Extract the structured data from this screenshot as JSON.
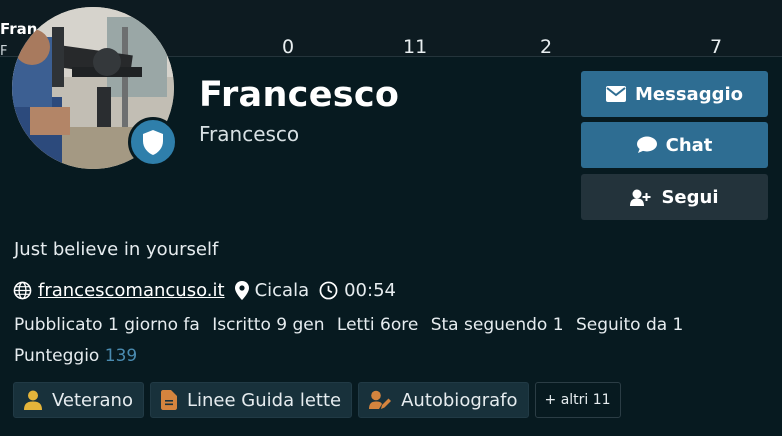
{
  "peek": {
    "title": "Fran",
    "subtitle": "F",
    "stats": [
      "0",
      "11",
      "2",
      "7"
    ]
  },
  "profile": {
    "display_name": "Francesco",
    "username": "Francesco",
    "motto": "Just believe in yourself",
    "website": "francescomancuso.it",
    "location": "Cicala",
    "local_time": "00:54"
  },
  "actions": {
    "message": "Messaggio",
    "chat": "Chat",
    "follow": "Segui"
  },
  "stats": {
    "posted": "Pubblicato 1 giorno fa",
    "joined": "Iscritto 9 gen",
    "read": "Letti 6ore",
    "following": "Sta seguendo 1",
    "followed": "Seguito da 1",
    "score_label": "Punteggio",
    "score_value": "139"
  },
  "badges": [
    {
      "label": "Veterano",
      "icon": "user-icon",
      "color": "#e4b43a"
    },
    {
      "label": "Linee Guida lette",
      "icon": "document-icon",
      "color": "#d4843e"
    },
    {
      "label": "Autobiografo",
      "icon": "user-edit-icon",
      "color": "#d4843e"
    }
  ],
  "more_badges": "+ altri 11",
  "colors": {
    "primary_button": "#2e6d92",
    "secondary_button": "#23333b",
    "background": "#071a20",
    "score": "#4a8bb0"
  }
}
